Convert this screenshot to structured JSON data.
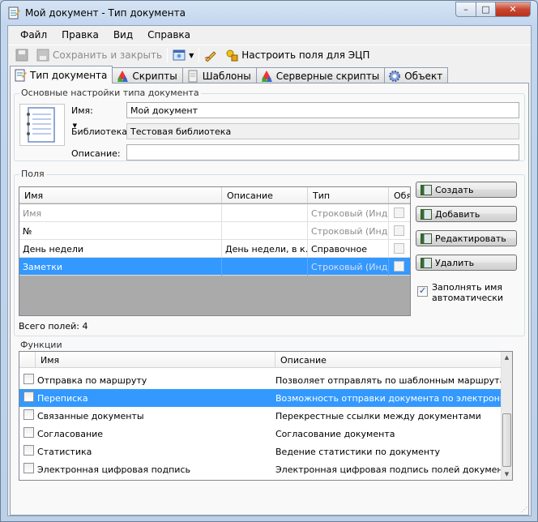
{
  "window": {
    "title": "Мой документ - Тип документа",
    "btn_min": "–",
    "btn_max": "□",
    "btn_close": "✕"
  },
  "menu": [
    "Файл",
    "Правка",
    "Вид",
    "Справка"
  ],
  "toolbar": {
    "save_close": "Сохранить и закрыть",
    "configure_ecp": "Настроить поля для ЭЦП"
  },
  "tabs": [
    {
      "label": "Тип документа",
      "icon": "document-type-icon"
    },
    {
      "label": "Скрипты",
      "icon": "scripts-icon"
    },
    {
      "label": "Шаблоны",
      "icon": "templates-icon"
    },
    {
      "label": "Серверные скрипты",
      "icon": "server-scripts-icon"
    },
    {
      "label": "Объект",
      "icon": "object-gear-icon"
    }
  ],
  "basic": {
    "group_title": "Основные настройки типа документа",
    "name_label": "Имя:",
    "name_value": "Мой документ",
    "library_label": "Библиотека:",
    "library_value": "Тестовая библиотека",
    "description_label": "Описание:",
    "description_value": ""
  },
  "fields": {
    "group_title": "Поля",
    "columns": [
      "Имя",
      "Описание",
      "Тип",
      "Обя:"
    ],
    "rows": [
      {
        "name": "Имя",
        "description": "",
        "type": "Строковый (Инд...",
        "required": false
      },
      {
        "name": "№",
        "description": "",
        "type": "Строковый (Инд...",
        "required": false
      },
      {
        "name": "День недели",
        "description": "День недели, в к...",
        "type": "Справочное",
        "required": false
      },
      {
        "name": "Заметки",
        "description": "",
        "type": "Строковый (Инд...",
        "required": false
      }
    ],
    "total": "Всего полей: 4",
    "buttons": {
      "create": "Создать",
      "add": "Добавить",
      "edit": "Редактировать",
      "delete": "Удалить"
    },
    "autofill_label": "Заполнять имя автоматически",
    "autofill_checked": true
  },
  "functions": {
    "group_title": "Функции",
    "columns": [
      "Имя",
      "Описание"
    ],
    "rows": [
      {
        "name": "Отправка по маршруту",
        "description": "Позволяет отправлять по шаблонным маршрутам",
        "checked": false
      },
      {
        "name": "Переписка",
        "description": "Возможность отправки документа по электронной по...",
        "checked": false
      },
      {
        "name": "Связанные документы",
        "description": "Перекрестные ссылки между документами",
        "checked": false
      },
      {
        "name": "Согласование",
        "description": "Согласование документа",
        "checked": false
      },
      {
        "name": "Статистика",
        "description": "Ведение статистики по документу",
        "checked": false
      },
      {
        "name": "Электронная цифровая подпись",
        "description": "Электронная цифровая подпись полей документа",
        "checked": false
      }
    ],
    "selected_index": 1
  }
}
